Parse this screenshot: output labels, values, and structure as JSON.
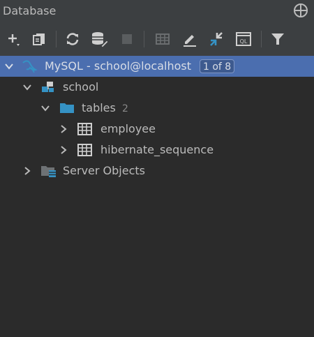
{
  "panel": {
    "title": "Database"
  },
  "toolbar": {
    "items": [
      {
        "icon": "add-icon"
      },
      {
        "icon": "duplicate-icon"
      },
      {
        "icon": "refresh-icon"
      },
      {
        "icon": "schema-settings-icon"
      },
      {
        "icon": "stop-icon"
      },
      {
        "icon": "table-editor-icon"
      },
      {
        "icon": "edit-icon"
      },
      {
        "icon": "jump-to-console-icon"
      },
      {
        "icon": "query-console-icon"
      },
      {
        "icon": "filter-icon"
      }
    ]
  },
  "tree": {
    "datasource": {
      "label": "MySQL - school@localhost",
      "badge": "1 of 8"
    },
    "schema": {
      "label": "school"
    },
    "tables_folder": {
      "label": "tables",
      "count": "2"
    },
    "tables": [
      {
        "label": "employee"
      },
      {
        "label": "hibernate_sequence"
      }
    ],
    "server_objects": {
      "label": "Server Objects"
    }
  },
  "colors": {
    "panel_bg": "#3c3f41",
    "tree_bg": "#2b2b2b",
    "selection": "#4b6eaf",
    "text": "#bbbbbb",
    "accent_blue": "#3592c4"
  }
}
